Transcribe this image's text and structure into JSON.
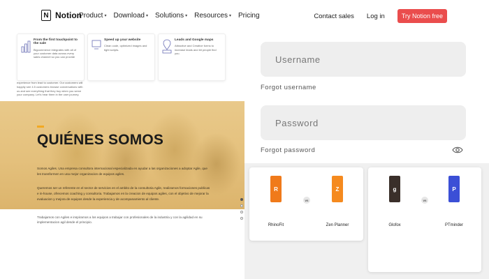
{
  "nav": {
    "logo_mark": "N",
    "logo_text": "Notion",
    "items": [
      "Product",
      "Download",
      "Solutions",
      "Resources",
      "Pricing"
    ],
    "contact": "Contact sales",
    "login": "Log in",
    "cta": "Try Notion free"
  },
  "features": [
    {
      "title": "From the first touchpoint to the sale",
      "body": "Bigcommerce integrates with all of your customer data across every sales channel so you can provide"
    },
    {
      "title": "Speed up your website",
      "body": "Clean code, optimized images and tight scripts."
    },
    {
      "title": "Leads and Google maps",
      "body": "Attractive and Creative forms to increase leads and let people find you."
    }
  ],
  "feature1_more": "experience from lead to customer. Our customers will happily see 4.5 customers browse conversations with us and see everything that they buy when you serve your company. Let's hear them in the user journey.",
  "hero": {
    "title": "QUIÉNES SOMOS",
    "para1": "Somos Agiles. Una empresa consultora internacional especializada en ayudar a las organizaciones a adoptar Agile, que les transformen en una mejor organizacion de equipos agiles.",
    "para2": "Queremos ser un referente en el sector de servicios en el ambito de la consultoria Agile, realizamos formaciones publicas e in-house, ofrecemos coaching y consultoria. Trabajamos en la creacion de equipos agiles, con el objetivo de mejorar la evaluacion y mejora de equipos desde la experiencia y de acompanamiento al cliente.",
    "para3": "Trabajamos con Agiles e inspiramos a los equipos a trabajar con profesionales de la industria y con la agilidad en su implementacion agil desde el principio."
  },
  "login": {
    "username_placeholder": "Username",
    "forgot_username": "Forgot username",
    "password_placeholder": "Password",
    "forgot_password": "Forgot password"
  },
  "compare": [
    {
      "left": {
        "name": "RhinoFit",
        "color": "#f07a1a",
        "mark": "R"
      },
      "vs": "vs",
      "right": {
        "name": "Zen Planner",
        "color": "#f58a1f",
        "mark": "Z"
      }
    },
    {
      "left": {
        "name": "Glofox",
        "color": "#3a2f2a",
        "mark": "g"
      },
      "vs": "vs",
      "right": {
        "name": "PTminder",
        "color": "#3b4fd6",
        "mark": "P"
      }
    }
  ],
  "colors": {
    "accent": "#ea4d4d",
    "hero_accent": "#f2a922"
  }
}
